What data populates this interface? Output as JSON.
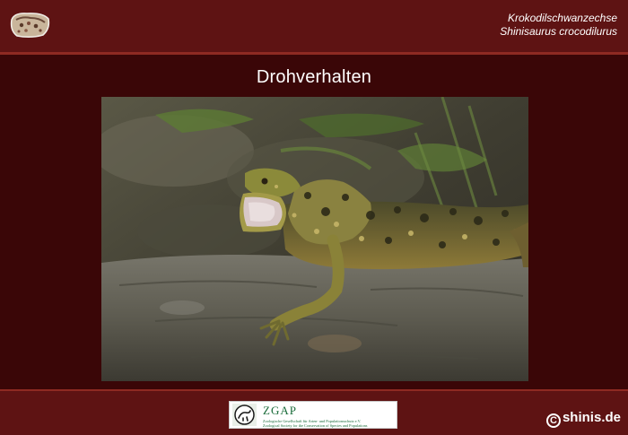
{
  "header": {
    "common_name": "Krokodilschwanzechse",
    "scientific_name": "Shinisaurus crocodilurus"
  },
  "slide": {
    "title": "Drohverhalten"
  },
  "footer": {
    "zgap_name": "ZGAP",
    "zgap_line_1": "Zoologische Gesellschaft für Arten- und Populationsschutz e.V.",
    "zgap_line_2": "Zoological Society for the Conservation of Species and Populations",
    "copyright_symbol": "C",
    "copyright_text": "shinis.de"
  },
  "colors": {
    "background": "#3a0607",
    "bar": "#5e1313",
    "accent_rule": "#8e2a22",
    "text": "#ffffff",
    "zgap_green": "#1a6c3a"
  },
  "icons": {
    "header_logo": "stone-logo-icon",
    "zgap_logo": "zgap-emblem-icon",
    "copyright": "copyright-icon"
  }
}
